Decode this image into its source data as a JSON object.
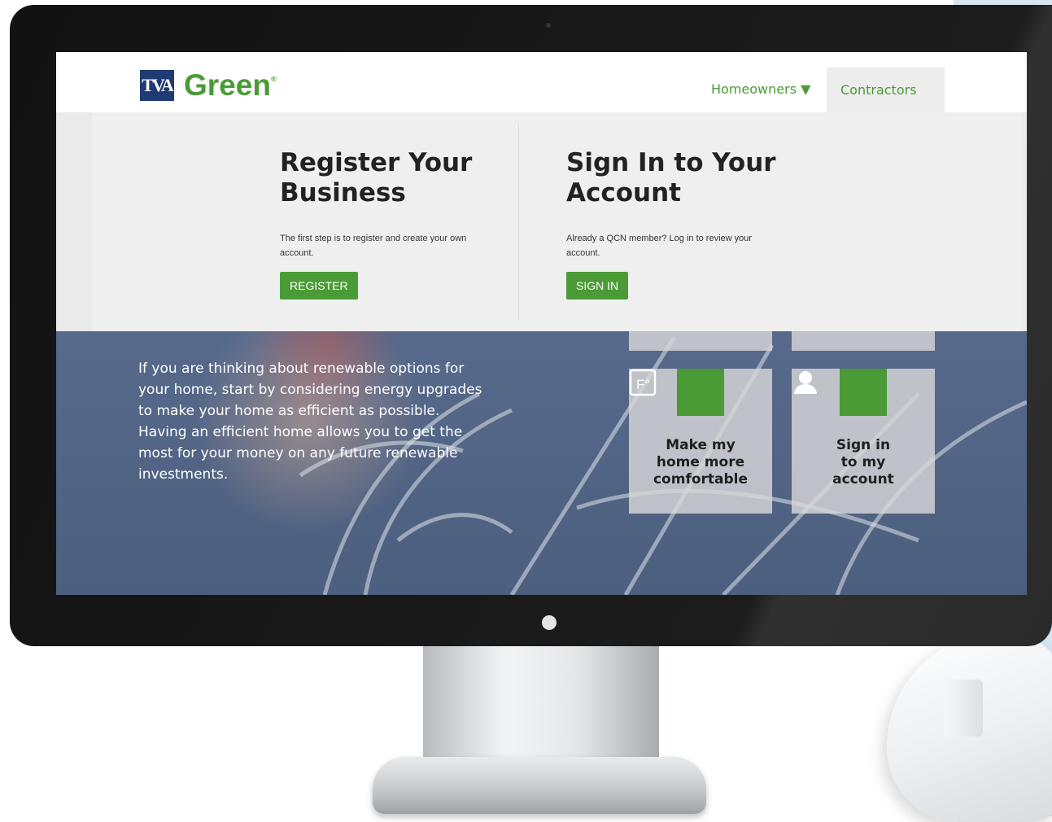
{
  "site": {
    "logo_mark": "TVA",
    "logo_text": "Green",
    "logo_reg": "®"
  },
  "nav": {
    "homeowners_label": "Homeowners ▼",
    "contractors_label": "Contractors"
  },
  "dropdown": {
    "register": {
      "title": "Register Your Business",
      "text": "The first step is to register and create your own account.",
      "button": "REGISTER"
    },
    "signin": {
      "title": "Sign In to Your Account",
      "text": "Already a QCN member? Log in to review your account.",
      "button": "SIGN IN"
    }
  },
  "hero": {
    "text": "If you are thinking about renewable options for your home, start by considering energy upgrades to make your home as efficient as possible. Having an efficient home allows you to get the most for your money on any future renewable investments."
  },
  "tiles": [
    {
      "label": "Make my home more comfortable",
      "icon": "thermometer-f-icon"
    },
    {
      "label": "Sign in to my account",
      "icon": "user-icon"
    }
  ],
  "colors": {
    "brand_green": "#4a9b36",
    "brand_navy": "#1e3b73"
  }
}
